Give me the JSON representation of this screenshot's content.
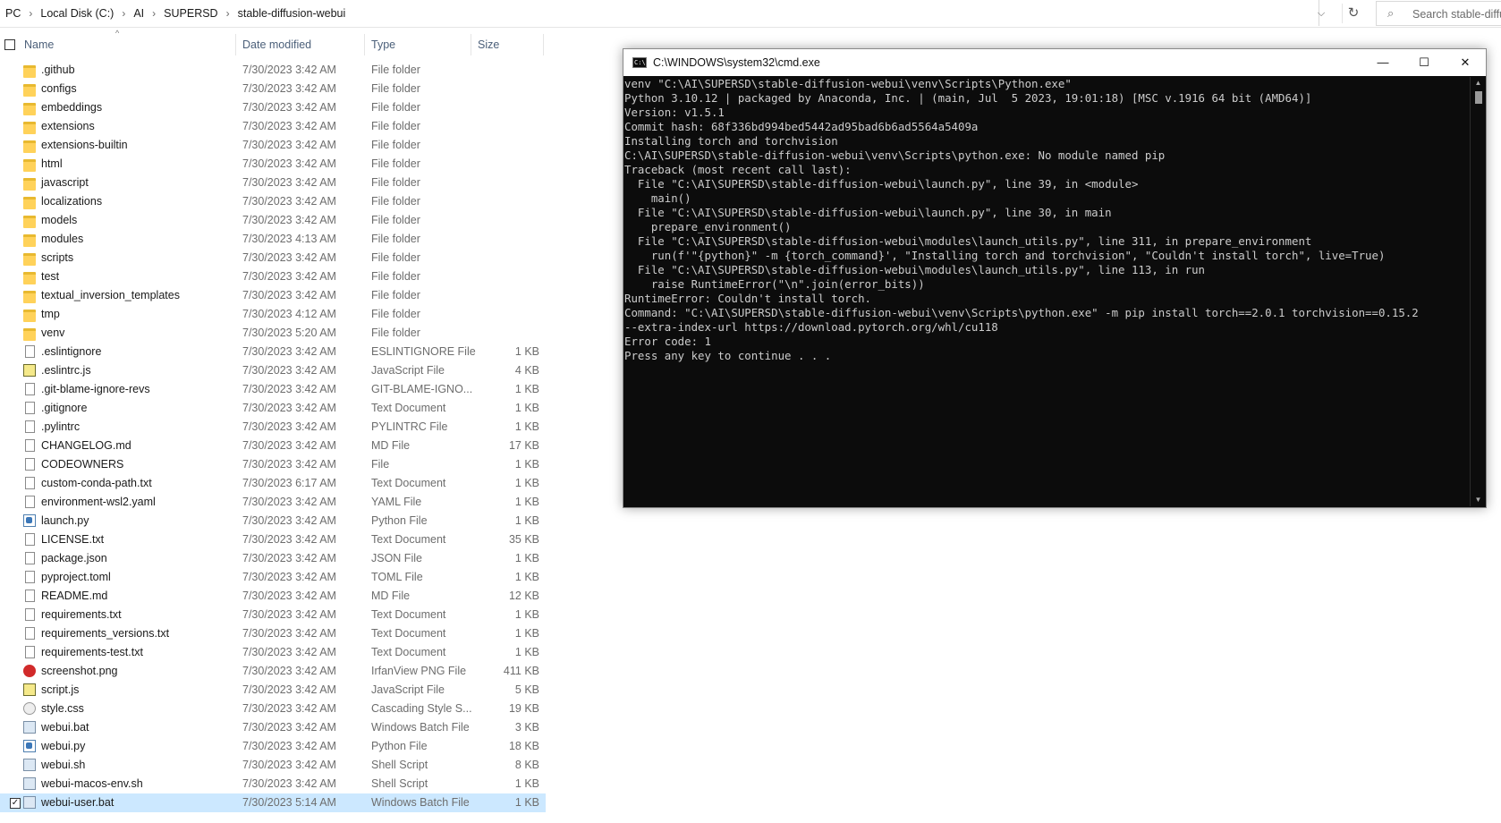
{
  "explorer": {
    "breadcrumb": [
      "PC",
      "Local Disk (C:)",
      "AI",
      "SUPERSD",
      "stable-diffusion-webui"
    ],
    "search_placeholder": "Search stable-diffu",
    "columns": {
      "name": "Name",
      "date": "Date modified",
      "type": "Type",
      "size": "Size"
    },
    "files": [
      {
        "name": ".github",
        "date": "7/30/2023 3:42 AM",
        "type": "File folder",
        "size": "",
        "icon": "folder-icon"
      },
      {
        "name": "configs",
        "date": "7/30/2023 3:42 AM",
        "type": "File folder",
        "size": "",
        "icon": "folder-icon"
      },
      {
        "name": "embeddings",
        "date": "7/30/2023 3:42 AM",
        "type": "File folder",
        "size": "",
        "icon": "folder-icon"
      },
      {
        "name": "extensions",
        "date": "7/30/2023 3:42 AM",
        "type": "File folder",
        "size": "",
        "icon": "folder-icon"
      },
      {
        "name": "extensions-builtin",
        "date": "7/30/2023 3:42 AM",
        "type": "File folder",
        "size": "",
        "icon": "folder-icon"
      },
      {
        "name": "html",
        "date": "7/30/2023 3:42 AM",
        "type": "File folder",
        "size": "",
        "icon": "folder-icon"
      },
      {
        "name": "javascript",
        "date": "7/30/2023 3:42 AM",
        "type": "File folder",
        "size": "",
        "icon": "folder-icon"
      },
      {
        "name": "localizations",
        "date": "7/30/2023 3:42 AM",
        "type": "File folder",
        "size": "",
        "icon": "folder-icon"
      },
      {
        "name": "models",
        "date": "7/30/2023 3:42 AM",
        "type": "File folder",
        "size": "",
        "icon": "folder-icon"
      },
      {
        "name": "modules",
        "date": "7/30/2023 4:13 AM",
        "type": "File folder",
        "size": "",
        "icon": "folder-icon"
      },
      {
        "name": "scripts",
        "date": "7/30/2023 3:42 AM",
        "type": "File folder",
        "size": "",
        "icon": "folder-icon"
      },
      {
        "name": "test",
        "date": "7/30/2023 3:42 AM",
        "type": "File folder",
        "size": "",
        "icon": "folder-icon"
      },
      {
        "name": "textual_inversion_templates",
        "date": "7/30/2023 3:42 AM",
        "type": "File folder",
        "size": "",
        "icon": "folder-icon"
      },
      {
        "name": "tmp",
        "date": "7/30/2023 4:12 AM",
        "type": "File folder",
        "size": "",
        "icon": "folder-icon"
      },
      {
        "name": "venv",
        "date": "7/30/2023 5:20 AM",
        "type": "File folder",
        "size": "",
        "icon": "folder-icon"
      },
      {
        "name": ".eslintignore",
        "date": "7/30/2023 3:42 AM",
        "type": "ESLINTIGNORE File",
        "size": "1 KB",
        "icon": "document-icon"
      },
      {
        "name": ".eslintrc.js",
        "date": "7/30/2023 3:42 AM",
        "type": "JavaScript File",
        "size": "4 KB",
        "icon": "javascript-file-icon"
      },
      {
        "name": ".git-blame-ignore-revs",
        "date": "7/30/2023 3:42 AM",
        "type": "GIT-BLAME-IGNO...",
        "size": "1 KB",
        "icon": "document-icon"
      },
      {
        "name": ".gitignore",
        "date": "7/30/2023 3:42 AM",
        "type": "Text Document",
        "size": "1 KB",
        "icon": "document-icon"
      },
      {
        "name": ".pylintrc",
        "date": "7/30/2023 3:42 AM",
        "type": "PYLINTRC File",
        "size": "1 KB",
        "icon": "document-icon"
      },
      {
        "name": "CHANGELOG.md",
        "date": "7/30/2023 3:42 AM",
        "type": "MD File",
        "size": "17 KB",
        "icon": "document-icon"
      },
      {
        "name": "CODEOWNERS",
        "date": "7/30/2023 3:42 AM",
        "type": "File",
        "size": "1 KB",
        "icon": "document-icon"
      },
      {
        "name": "custom-conda-path.txt",
        "date": "7/30/2023 6:17 AM",
        "type": "Text Document",
        "size": "1 KB",
        "icon": "document-icon"
      },
      {
        "name": "environment-wsl2.yaml",
        "date": "7/30/2023 3:42 AM",
        "type": "YAML File",
        "size": "1 KB",
        "icon": "document-icon"
      },
      {
        "name": "launch.py",
        "date": "7/30/2023 3:42 AM",
        "type": "Python File",
        "size": "1 KB",
        "icon": "python-file-icon"
      },
      {
        "name": "LICENSE.txt",
        "date": "7/30/2023 3:42 AM",
        "type": "Text Document",
        "size": "35 KB",
        "icon": "document-icon"
      },
      {
        "name": "package.json",
        "date": "7/30/2023 3:42 AM",
        "type": "JSON File",
        "size": "1 KB",
        "icon": "document-icon"
      },
      {
        "name": "pyproject.toml",
        "date": "7/30/2023 3:42 AM",
        "type": "TOML File",
        "size": "1 KB",
        "icon": "document-icon"
      },
      {
        "name": "README.md",
        "date": "7/30/2023 3:42 AM",
        "type": "MD File",
        "size": "12 KB",
        "icon": "document-icon"
      },
      {
        "name": "requirements.txt",
        "date": "7/30/2023 3:42 AM",
        "type": "Text Document",
        "size": "1 KB",
        "icon": "document-icon"
      },
      {
        "name": "requirements_versions.txt",
        "date": "7/30/2023 3:42 AM",
        "type": "Text Document",
        "size": "1 KB",
        "icon": "document-icon"
      },
      {
        "name": "requirements-test.txt",
        "date": "7/30/2023 3:42 AM",
        "type": "Text Document",
        "size": "1 KB",
        "icon": "document-icon"
      },
      {
        "name": "screenshot.png",
        "date": "7/30/2023 3:42 AM",
        "type": "IrfanView PNG File",
        "size": "411 KB",
        "icon": "image-file-icon"
      },
      {
        "name": "script.js",
        "date": "7/30/2023 3:42 AM",
        "type": "JavaScript File",
        "size": "5 KB",
        "icon": "javascript-file-icon"
      },
      {
        "name": "style.css",
        "date": "7/30/2023 3:42 AM",
        "type": "Cascading Style S...",
        "size": "19 KB",
        "icon": "css-file-icon"
      },
      {
        "name": "webui.bat",
        "date": "7/30/2023 3:42 AM",
        "type": "Windows Batch File",
        "size": "3 KB",
        "icon": "batch-file-icon"
      },
      {
        "name": "webui.py",
        "date": "7/30/2023 3:42 AM",
        "type": "Python File",
        "size": "18 KB",
        "icon": "python-file-icon"
      },
      {
        "name": "webui.sh",
        "date": "7/30/2023 3:42 AM",
        "type": "Shell Script",
        "size": "8 KB",
        "icon": "batch-file-icon"
      },
      {
        "name": "webui-macos-env.sh",
        "date": "7/30/2023 3:42 AM",
        "type": "Shell Script",
        "size": "1 KB",
        "icon": "batch-file-icon"
      },
      {
        "name": "webui-user.bat",
        "date": "7/30/2023 5:14 AM",
        "type": "Windows Batch File",
        "size": "1 KB",
        "icon": "batch-file-icon",
        "selected": true
      }
    ]
  },
  "cmd": {
    "title": "C:\\WINDOWS\\system32\\cmd.exe",
    "icon_text": "C:\\",
    "lines": [
      "venv \"C:\\AI\\SUPERSD\\stable-diffusion-webui\\venv\\Scripts\\Python.exe\"",
      "Python 3.10.12 | packaged by Anaconda, Inc. | (main, Jul  5 2023, 19:01:18) [MSC v.1916 64 bit (AMD64)]",
      "Version: v1.5.1",
      "Commit hash: 68f336bd994bed5442ad95bad6b6ad5564a5409a",
      "Installing torch and torchvision",
      "C:\\AI\\SUPERSD\\stable-diffusion-webui\\venv\\Scripts\\python.exe: No module named pip",
      "Traceback (most recent call last):",
      "  File \"C:\\AI\\SUPERSD\\stable-diffusion-webui\\launch.py\", line 39, in <module>",
      "    main()",
      "  File \"C:\\AI\\SUPERSD\\stable-diffusion-webui\\launch.py\", line 30, in main",
      "    prepare_environment()",
      "  File \"C:\\AI\\SUPERSD\\stable-diffusion-webui\\modules\\launch_utils.py\", line 311, in prepare_environment",
      "    run(f'\"{python}\" -m {torch_command}', \"Installing torch and torchvision\", \"Couldn't install torch\", live=True)",
      "  File \"C:\\AI\\SUPERSD\\stable-diffusion-webui\\modules\\launch_utils.py\", line 113, in run",
      "    raise RuntimeError(\"\\n\".join(error_bits))",
      "RuntimeError: Couldn't install torch.",
      "Command: \"C:\\AI\\SUPERSD\\stable-diffusion-webui\\venv\\Scripts\\python.exe\" -m pip install torch==2.0.1 torchvision==0.15.2",
      "--extra-index-url https://download.pytorch.org/whl/cu118",
      "Error code: 1",
      "Press any key to continue . . ."
    ],
    "minimize": "—",
    "maximize": "☐",
    "close": "✕"
  }
}
